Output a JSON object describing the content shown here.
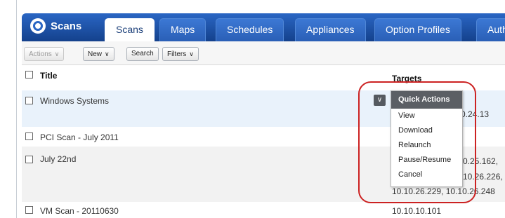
{
  "topbar": {
    "logo_label": "Scans",
    "tabs": [
      {
        "label": "Scans",
        "active": true
      },
      {
        "label": "Maps",
        "active": false
      },
      {
        "label": "Schedules",
        "active": false
      },
      {
        "label": "Appliances",
        "active": false
      },
      {
        "label": "Option Profiles",
        "active": false
      },
      {
        "label": "Authe",
        "active": false
      }
    ]
  },
  "toolbar": {
    "actions_label": "Actions",
    "new_label": "New",
    "search_label": "Search",
    "filters_label": "Filters"
  },
  "table": {
    "col_title": "Title",
    "col_targets": "Targets",
    "rows": [
      {
        "title": "Windows Systems",
        "targets": [
          "0.24.13"
        ]
      },
      {
        "title": "PCI Scan - July 2011",
        "targets": [
          ""
        ]
      },
      {
        "title": "July 22nd",
        "targets": [
          "0.25.162,",
          "10.26.226,",
          "10.10.26.229, 10.10.26.248"
        ]
      },
      {
        "title": "VM Scan - 20110630",
        "targets": [
          "10.10.10.101"
        ]
      }
    ]
  },
  "quick_actions": {
    "header": "Quick Actions",
    "items": [
      "View",
      "Download",
      "Relaunch",
      "Pause/Resume",
      "Cancel"
    ]
  },
  "colors": {
    "brand_blue": "#1a4fa0",
    "highlight_red": "#cc2222",
    "menu_header": "#5b5f64",
    "selected_row": "#e9f2fb"
  }
}
